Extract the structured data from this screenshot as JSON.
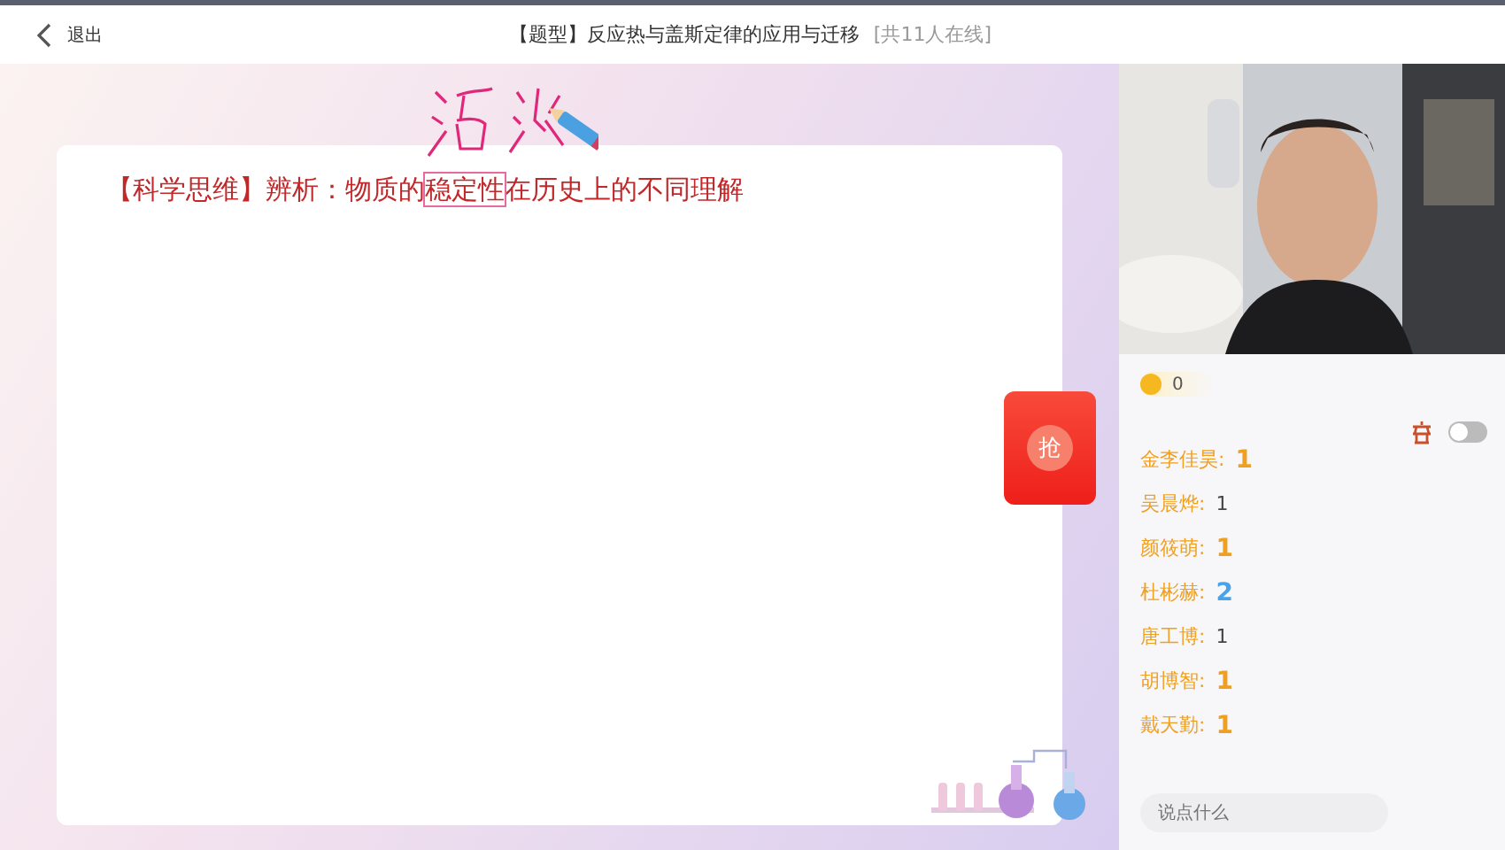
{
  "top_bar": {
    "back_label": "退出",
    "title": "【题型】反应热与盖斯定律的应用与迁移",
    "online": "[共11人在线]"
  },
  "slide": {
    "heading_parts": [
      {
        "text": "【科学思维】辨析：物质的",
        "boxed": false
      },
      {
        "text": "稳定性",
        "boxed": true
      },
      {
        "text": "在历史上的不同理解",
        "boxed": false
      }
    ]
  },
  "red_packet": {
    "label": "抢"
  },
  "coins": {
    "count": "0"
  },
  "toggle": {
    "on": false
  },
  "chat": [
    {
      "name": "金李佳昊:",
      "kind": "medal",
      "badge": "1",
      "color": "#f0a020"
    },
    {
      "name": "吴晨烨:",
      "kind": "plain",
      "badge": "1"
    },
    {
      "name": "颜筱萌:",
      "kind": "medal",
      "badge": "1",
      "color": "#f0a020"
    },
    {
      "name": "杜彬赫:",
      "kind": "medal",
      "badge": "2",
      "color": "#4aa3e8"
    },
    {
      "name": "唐工博:",
      "kind": "plain",
      "badge": "1"
    },
    {
      "name": "胡博智:",
      "kind": "medal",
      "badge": "1",
      "color": "#f0a020"
    },
    {
      "name": "戴天勤:",
      "kind": "medal",
      "badge": "1",
      "color": "#f0a020"
    }
  ],
  "chat_input": {
    "placeholder": "说点什么"
  }
}
